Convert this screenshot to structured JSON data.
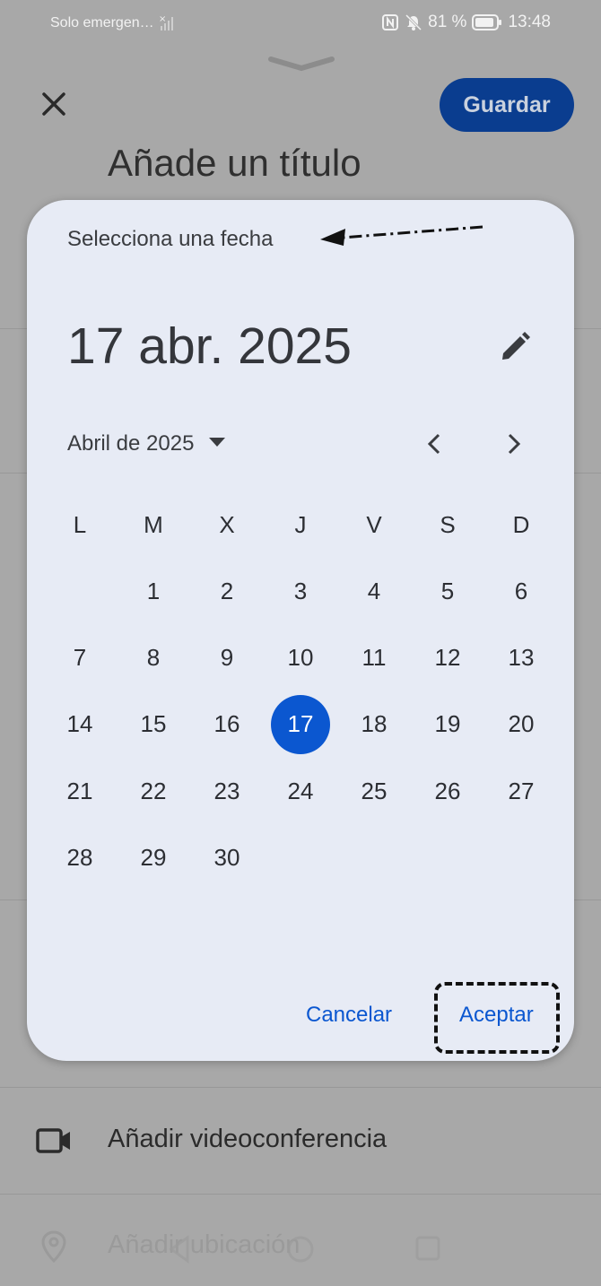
{
  "status_bar": {
    "carrier": "Solo emergen…",
    "battery_percent": "81 %",
    "time": "13:48"
  },
  "background": {
    "save_label": "Guardar",
    "title_placeholder": "Añade un título",
    "rows": [
      {
        "label": "Añadir videoconferencia"
      },
      {
        "label": "Añadir ubicación"
      }
    ]
  },
  "date_picker": {
    "heading": "Selecciona una fecha",
    "selected_date": "17 abr. 2025",
    "month_label": "Abril de 2025",
    "weekdays": [
      "L",
      "M",
      "X",
      "J",
      "V",
      "S",
      "D"
    ],
    "weeks": [
      [
        "",
        "1",
        "2",
        "3",
        "4",
        "5",
        "6"
      ],
      [
        "7",
        "8",
        "9",
        "10",
        "11",
        "12",
        "13"
      ],
      [
        "14",
        "15",
        "16",
        "17",
        "18",
        "19",
        "20"
      ],
      [
        "21",
        "22",
        "23",
        "24",
        "25",
        "26",
        "27"
      ],
      [
        "28",
        "29",
        "30",
        "",
        "",
        "",
        ""
      ]
    ],
    "selected_day": "17",
    "cancel_label": "Cancelar",
    "accept_label": "Aceptar"
  },
  "colors": {
    "accent": "#0b57d0",
    "dialog_bg": "#e7ebf5",
    "scrim": "#a8a8a8",
    "save_button_bg": "#0a3d8f"
  }
}
